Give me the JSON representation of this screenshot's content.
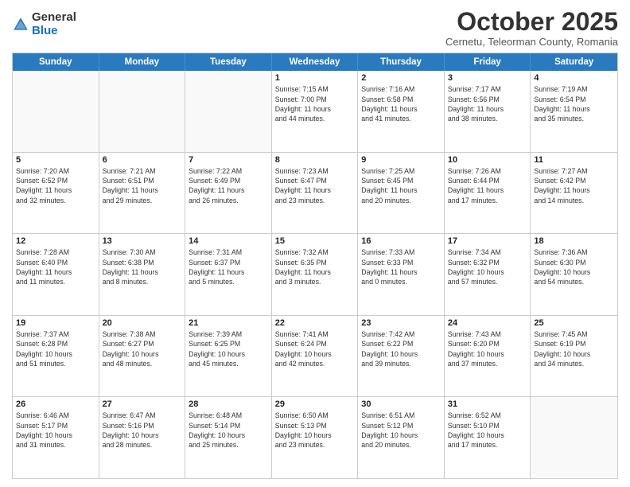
{
  "logo": {
    "general": "General",
    "blue": "Blue"
  },
  "header": {
    "month": "October 2025",
    "location": "Cernetu, Teleorman County, Romania"
  },
  "weekdays": [
    "Sunday",
    "Monday",
    "Tuesday",
    "Wednesday",
    "Thursday",
    "Friday",
    "Saturday"
  ],
  "weeks": [
    [
      {
        "day": "",
        "info": ""
      },
      {
        "day": "",
        "info": ""
      },
      {
        "day": "",
        "info": ""
      },
      {
        "day": "1",
        "info": "Sunrise: 7:15 AM\nSunset: 7:00 PM\nDaylight: 11 hours\nand 44 minutes."
      },
      {
        "day": "2",
        "info": "Sunrise: 7:16 AM\nSunset: 6:58 PM\nDaylight: 11 hours\nand 41 minutes."
      },
      {
        "day": "3",
        "info": "Sunrise: 7:17 AM\nSunset: 6:56 PM\nDaylight: 11 hours\nand 38 minutes."
      },
      {
        "day": "4",
        "info": "Sunrise: 7:19 AM\nSunset: 6:54 PM\nDaylight: 11 hours\nand 35 minutes."
      }
    ],
    [
      {
        "day": "5",
        "info": "Sunrise: 7:20 AM\nSunset: 6:52 PM\nDaylight: 11 hours\nand 32 minutes."
      },
      {
        "day": "6",
        "info": "Sunrise: 7:21 AM\nSunset: 6:51 PM\nDaylight: 11 hours\nand 29 minutes."
      },
      {
        "day": "7",
        "info": "Sunrise: 7:22 AM\nSunset: 6:49 PM\nDaylight: 11 hours\nand 26 minutes."
      },
      {
        "day": "8",
        "info": "Sunrise: 7:23 AM\nSunset: 6:47 PM\nDaylight: 11 hours\nand 23 minutes."
      },
      {
        "day": "9",
        "info": "Sunrise: 7:25 AM\nSunset: 6:45 PM\nDaylight: 11 hours\nand 20 minutes."
      },
      {
        "day": "10",
        "info": "Sunrise: 7:26 AM\nSunset: 6:44 PM\nDaylight: 11 hours\nand 17 minutes."
      },
      {
        "day": "11",
        "info": "Sunrise: 7:27 AM\nSunset: 6:42 PM\nDaylight: 11 hours\nand 14 minutes."
      }
    ],
    [
      {
        "day": "12",
        "info": "Sunrise: 7:28 AM\nSunset: 6:40 PM\nDaylight: 11 hours\nand 11 minutes."
      },
      {
        "day": "13",
        "info": "Sunrise: 7:30 AM\nSunset: 6:38 PM\nDaylight: 11 hours\nand 8 minutes."
      },
      {
        "day": "14",
        "info": "Sunrise: 7:31 AM\nSunset: 6:37 PM\nDaylight: 11 hours\nand 5 minutes."
      },
      {
        "day": "15",
        "info": "Sunrise: 7:32 AM\nSunset: 6:35 PM\nDaylight: 11 hours\nand 3 minutes."
      },
      {
        "day": "16",
        "info": "Sunrise: 7:33 AM\nSunset: 6:33 PM\nDaylight: 11 hours\nand 0 minutes."
      },
      {
        "day": "17",
        "info": "Sunrise: 7:34 AM\nSunset: 6:32 PM\nDaylight: 10 hours\nand 57 minutes."
      },
      {
        "day": "18",
        "info": "Sunrise: 7:36 AM\nSunset: 6:30 PM\nDaylight: 10 hours\nand 54 minutes."
      }
    ],
    [
      {
        "day": "19",
        "info": "Sunrise: 7:37 AM\nSunset: 6:28 PM\nDaylight: 10 hours\nand 51 minutes."
      },
      {
        "day": "20",
        "info": "Sunrise: 7:38 AM\nSunset: 6:27 PM\nDaylight: 10 hours\nand 48 minutes."
      },
      {
        "day": "21",
        "info": "Sunrise: 7:39 AM\nSunset: 6:25 PM\nDaylight: 10 hours\nand 45 minutes."
      },
      {
        "day": "22",
        "info": "Sunrise: 7:41 AM\nSunset: 6:24 PM\nDaylight: 10 hours\nand 42 minutes."
      },
      {
        "day": "23",
        "info": "Sunrise: 7:42 AM\nSunset: 6:22 PM\nDaylight: 10 hours\nand 39 minutes."
      },
      {
        "day": "24",
        "info": "Sunrise: 7:43 AM\nSunset: 6:20 PM\nDaylight: 10 hours\nand 37 minutes."
      },
      {
        "day": "25",
        "info": "Sunrise: 7:45 AM\nSunset: 6:19 PM\nDaylight: 10 hours\nand 34 minutes."
      }
    ],
    [
      {
        "day": "26",
        "info": "Sunrise: 6:46 AM\nSunset: 5:17 PM\nDaylight: 10 hours\nand 31 minutes."
      },
      {
        "day": "27",
        "info": "Sunrise: 6:47 AM\nSunset: 5:16 PM\nDaylight: 10 hours\nand 28 minutes."
      },
      {
        "day": "28",
        "info": "Sunrise: 6:48 AM\nSunset: 5:14 PM\nDaylight: 10 hours\nand 25 minutes."
      },
      {
        "day": "29",
        "info": "Sunrise: 6:50 AM\nSunset: 5:13 PM\nDaylight: 10 hours\nand 23 minutes."
      },
      {
        "day": "30",
        "info": "Sunrise: 6:51 AM\nSunset: 5:12 PM\nDaylight: 10 hours\nand 20 minutes."
      },
      {
        "day": "31",
        "info": "Sunrise: 6:52 AM\nSunset: 5:10 PM\nDaylight: 10 hours\nand 17 minutes."
      },
      {
        "day": "",
        "info": ""
      }
    ]
  ]
}
